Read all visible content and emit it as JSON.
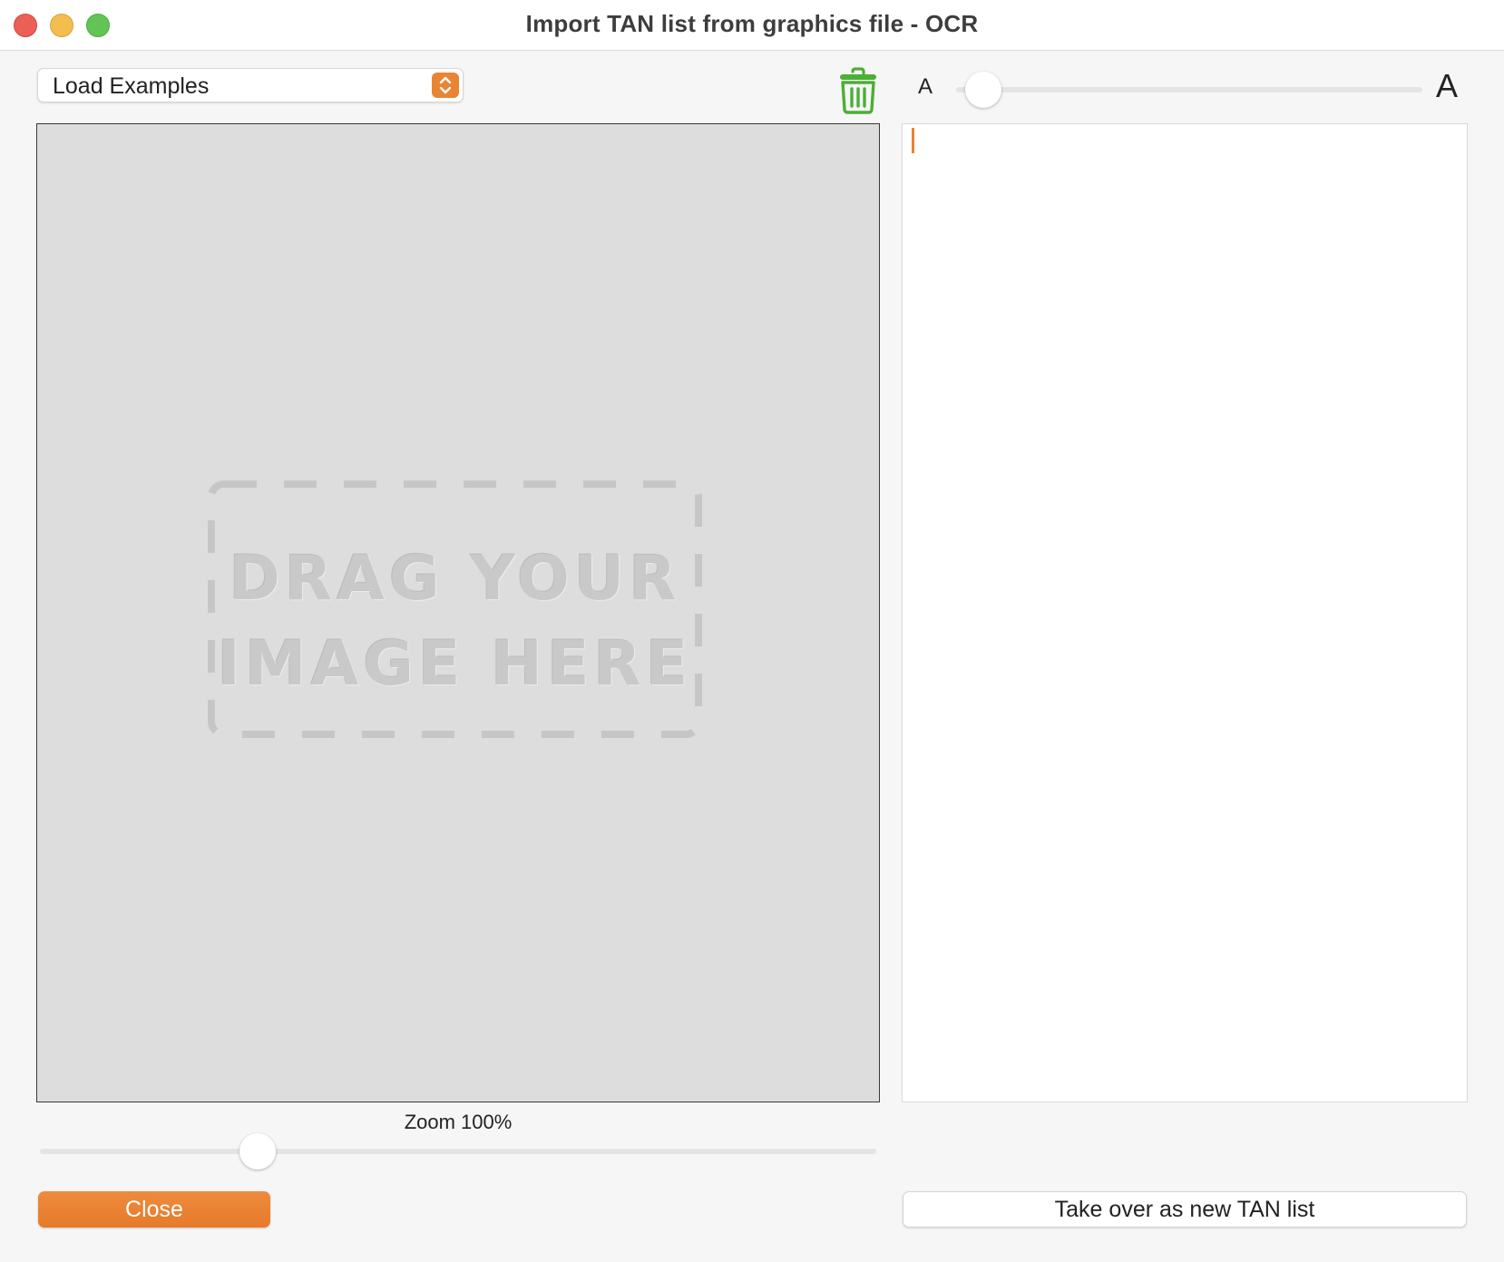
{
  "window": {
    "title": "Import TAN list from graphics file - OCR"
  },
  "toolbar": {
    "examples_popup": {
      "selected": "Load Examples",
      "icon": "chevron-up-down-icon"
    },
    "trash_icon": "trash-icon",
    "font_size": {
      "small_label": "A",
      "large_label": "A",
      "value": 0.05
    }
  },
  "image_panel": {
    "placeholder_line1": "DRAG YOUR",
    "placeholder_line2": "IMAGE HERE"
  },
  "zoom": {
    "label": "Zoom 100%",
    "value": 0.25
  },
  "buttons": {
    "close_label": "Close",
    "takeover_label": "Take over as new TAN list"
  },
  "colors": {
    "accent": "#e98433",
    "trash": "#4caf36"
  }
}
